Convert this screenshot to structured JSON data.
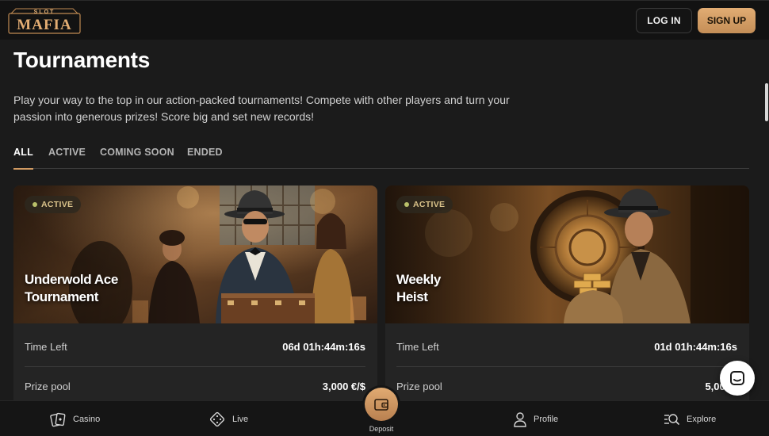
{
  "header": {
    "logo_top": "SLOT",
    "logo_main": "MAFIA",
    "login_label": "LOG IN",
    "signup_label": "SIGN UP"
  },
  "page": {
    "title": "Tournaments",
    "intro": "Play your way to the top in our action-packed tournaments! Compete with other players and turn your passion into generous prizes! Score big and set new records!"
  },
  "tabs": [
    {
      "label": "ALL",
      "active": true
    },
    {
      "label": "ACTIVE",
      "active": false
    },
    {
      "label": "COMING SOON",
      "active": false
    },
    {
      "label": "ENDED",
      "active": false
    }
  ],
  "tournaments": [
    {
      "status": "ACTIVE",
      "title_line1": "Underwold Ace",
      "title_line2": "Tournament",
      "time_left_label": "Time Left",
      "time_left": "06d 01h:44m:16s",
      "prize_label": "Prize pool",
      "prize": "3,000 €/$"
    },
    {
      "status": "ACTIVE",
      "title_line1": "Weekly",
      "title_line2": "Heist",
      "time_left_label": "Time Left",
      "time_left": "01d 01h:44m:16s",
      "prize_label": "Prize pool",
      "prize": "5,000"
    }
  ],
  "bottom_nav": {
    "casino": "Casino",
    "live": "Live",
    "deposit": "Deposit",
    "profile": "Profile",
    "explore": "Explore"
  },
  "colors": {
    "accent": "#d19a62",
    "background": "#1b1b1b",
    "header": "#121212",
    "card": "#242424",
    "active_dot": "#b9c06a"
  },
  "icons": {
    "casino": "cards-icon",
    "live": "dice-icon",
    "deposit": "wallet-icon",
    "profile": "user-icon",
    "explore": "search-list-icon",
    "chat": "chat-icon"
  }
}
